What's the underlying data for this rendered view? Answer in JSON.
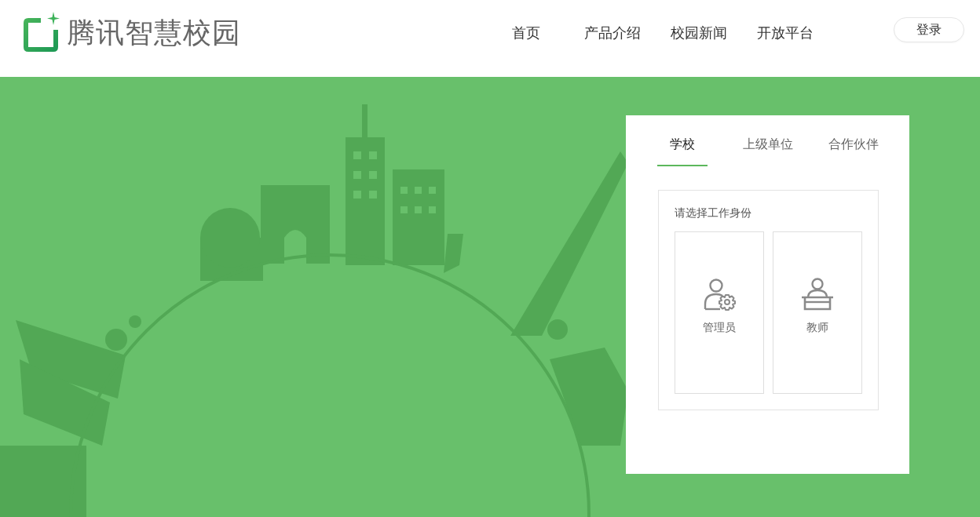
{
  "header": {
    "logo_text": "腾讯智慧校园",
    "nav": [
      "首页",
      "产品介绍",
      "校园新闻",
      "开放平台"
    ],
    "login_button": "登录"
  },
  "login_panel": {
    "tabs": [
      {
        "label": "学校",
        "selected": true
      },
      {
        "label": "上级单位",
        "selected": false
      },
      {
        "label": "合作伙伴",
        "selected": false
      }
    ],
    "prompt": "请选择工作身份",
    "roles": [
      {
        "kind": "admin",
        "label": "管理员"
      },
      {
        "kind": "teacher",
        "label": "教师"
      }
    ]
  }
}
